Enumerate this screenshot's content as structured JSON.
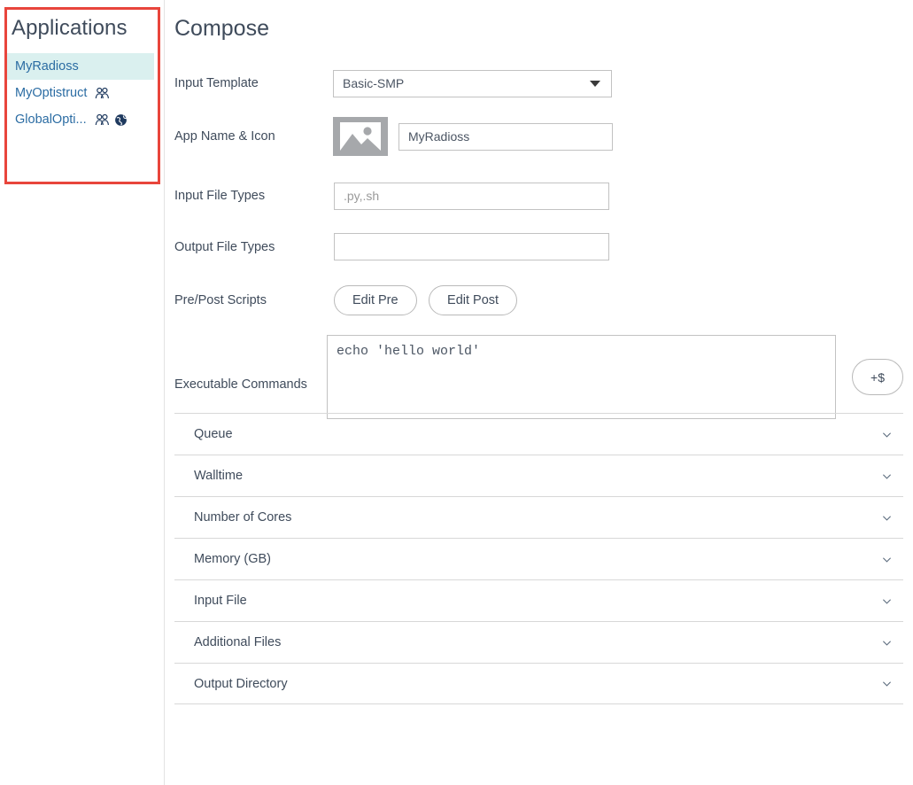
{
  "sidebar": {
    "title": "Applications",
    "items": [
      {
        "label": "MyRadioss",
        "selected": true,
        "icons": []
      },
      {
        "label": "MyOptistruct",
        "selected": false,
        "icons": [
          "people-icon"
        ]
      },
      {
        "label": "GlobalOpti...",
        "selected": false,
        "icons": [
          "people-icon",
          "globe-icon"
        ]
      }
    ],
    "highlight_color": "#daf0ef",
    "border_color": "#e8453c",
    "link_color": "#2b6ca3"
  },
  "main": {
    "title": "Compose",
    "fields": {
      "input_template": {
        "label": "Input Template",
        "value": "Basic-SMP",
        "icon": "chevron-down-icon"
      },
      "app_name_icon": {
        "label": "App Name & Icon",
        "value": "MyRadioss",
        "placeholder": "",
        "thumb_icon": "image-placeholder-icon"
      },
      "input_file_types": {
        "label": "Input File Types",
        "value": "",
        "placeholder": ".py,.sh"
      },
      "output_file_types": {
        "label": "Output File Types",
        "value": "",
        "placeholder": ""
      },
      "pre_post_scripts": {
        "label": "Pre/Post Scripts",
        "edit_pre_label": "Edit Pre",
        "edit_post_label": "Edit Post"
      },
      "executable_commands": {
        "label": "Executable Commands",
        "value": "echo 'hello world'",
        "add_variable_label": "+$"
      }
    },
    "accordion": [
      {
        "label": "Queue",
        "icon": "chevron-down-icon"
      },
      {
        "label": "Walltime",
        "icon": "chevron-down-icon"
      },
      {
        "label": "Number of Cores",
        "icon": "chevron-down-icon"
      },
      {
        "label": "Memory (GB)",
        "icon": "chevron-down-icon"
      },
      {
        "label": "Input File",
        "icon": "chevron-down-icon"
      },
      {
        "label": "Additional Files",
        "icon": "chevron-down-icon"
      },
      {
        "label": "Output Directory",
        "icon": "chevron-down-icon"
      }
    ]
  }
}
